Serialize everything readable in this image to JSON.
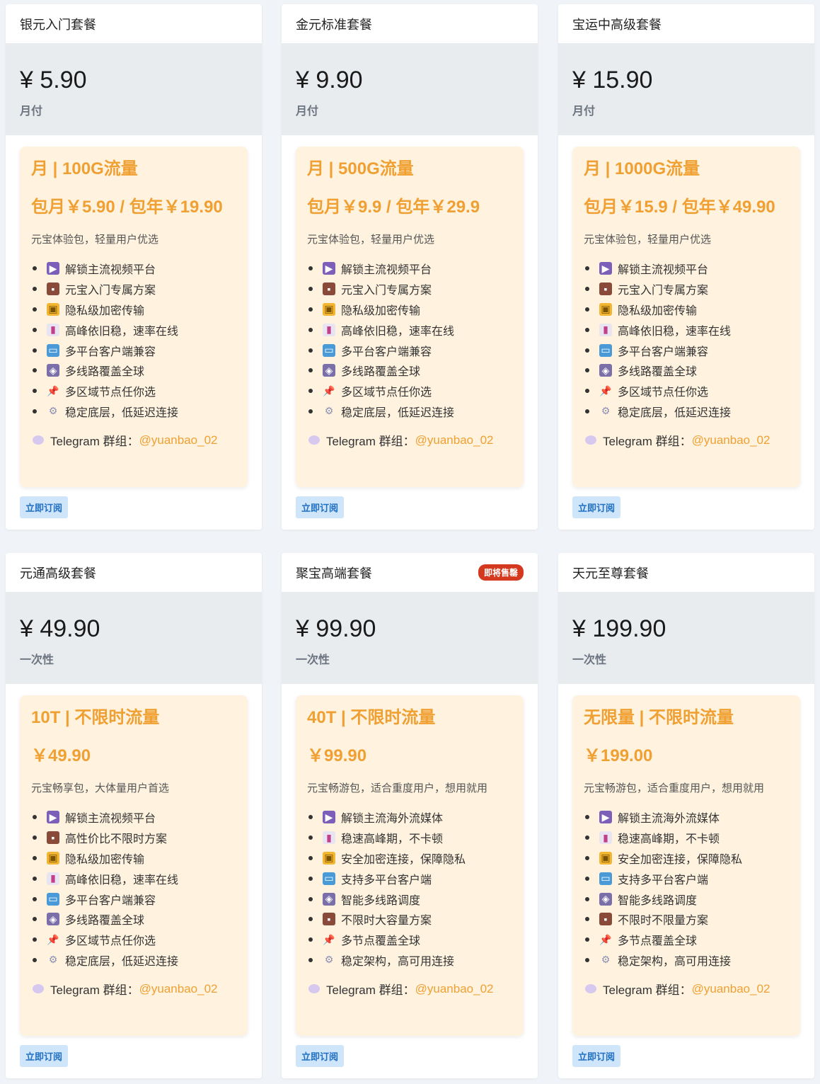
{
  "cards": [
    {
      "name": "银元入门套餐",
      "price": "¥ 5.90",
      "period": "月付",
      "plan_title": "月 | 100G流量",
      "plan_price": "包月￥5.90 / 包年￥19.90",
      "desc": "元宝体验包，轻量用户优选",
      "features": [
        {
          "icon": "film-icon",
          "text": "解锁主流视频平台"
        },
        {
          "icon": "briefcase-icon",
          "text": "元宝入门专属方案"
        },
        {
          "icon": "lock-icon",
          "text": "隐私级加密传输"
        },
        {
          "icon": "chart-icon",
          "text": "高峰依旧稳，速率在线"
        },
        {
          "icon": "computer-icon",
          "text": "多平台客户端兼容"
        },
        {
          "icon": "satellite-icon",
          "text": "多线路覆盖全球"
        },
        {
          "icon": "pin-icon",
          "text": "多区域节点任你选"
        },
        {
          "icon": "gear-icon",
          "text": "稳定底层，低延迟连接"
        }
      ],
      "tg_label": "Telegram 群组：",
      "tg_handle": "@yuanbao_02",
      "button": "立即订阅"
    },
    {
      "name": "金元标准套餐",
      "price": "¥ 9.90",
      "period": "月付",
      "plan_title": "月 | 500G流量",
      "plan_price": "包月￥9.9 / 包年￥29.9",
      "desc": "元宝体验包，轻量用户优选",
      "features": [
        {
          "icon": "film-icon",
          "text": "解锁主流视频平台"
        },
        {
          "icon": "briefcase-icon",
          "text": "元宝入门专属方案"
        },
        {
          "icon": "lock-icon",
          "text": "隐私级加密传输"
        },
        {
          "icon": "chart-icon",
          "text": "高峰依旧稳，速率在线"
        },
        {
          "icon": "computer-icon",
          "text": "多平台客户端兼容"
        },
        {
          "icon": "satellite-icon",
          "text": "多线路覆盖全球"
        },
        {
          "icon": "pin-icon",
          "text": "多区域节点任你选"
        },
        {
          "icon": "gear-icon",
          "text": "稳定底层，低延迟连接"
        }
      ],
      "tg_label": "Telegram 群组：",
      "tg_handle": "@yuanbao_02",
      "button": "立即订阅"
    },
    {
      "name": "宝运中高级套餐",
      "price": "¥ 15.90",
      "period": "月付",
      "plan_title": "月 | 1000G流量",
      "plan_price": "包月￥15.9 / 包年￥49.90",
      "desc": "元宝体验包，轻量用户优选",
      "features": [
        {
          "icon": "film-icon",
          "text": "解锁主流视频平台"
        },
        {
          "icon": "briefcase-icon",
          "text": "元宝入门专属方案"
        },
        {
          "icon": "lock-icon",
          "text": "隐私级加密传输"
        },
        {
          "icon": "chart-icon",
          "text": "高峰依旧稳，速率在线"
        },
        {
          "icon": "computer-icon",
          "text": "多平台客户端兼容"
        },
        {
          "icon": "satellite-icon",
          "text": "多线路覆盖全球"
        },
        {
          "icon": "pin-icon",
          "text": "多区域节点任你选"
        },
        {
          "icon": "gear-icon",
          "text": "稳定底层，低延迟连接"
        }
      ],
      "tg_label": "Telegram 群组：",
      "tg_handle": "@yuanbao_02",
      "button": "立即订阅"
    },
    {
      "name": "元通高级套餐",
      "price": "¥ 49.90",
      "period": "一次性",
      "plan_title": "10T | 不限时流量",
      "plan_price": "￥49.90",
      "desc": "元宝畅享包，大体量用户首选",
      "features": [
        {
          "icon": "film-icon",
          "text": "解锁主流视频平台"
        },
        {
          "icon": "briefcase-icon",
          "text": "高性价比不限时方案"
        },
        {
          "icon": "lock-icon",
          "text": "隐私级加密传输"
        },
        {
          "icon": "chart-icon",
          "text": "高峰依旧稳，速率在线"
        },
        {
          "icon": "computer-icon",
          "text": "多平台客户端兼容"
        },
        {
          "icon": "satellite-icon",
          "text": "多线路覆盖全球"
        },
        {
          "icon": "pin-icon",
          "text": "多区域节点任你选"
        },
        {
          "icon": "gear-icon",
          "text": "稳定底层，低延迟连接"
        }
      ],
      "tg_label": "Telegram 群组：",
      "tg_handle": "@yuanbao_02",
      "button": "立即订阅"
    },
    {
      "name": "聚宝高端套餐",
      "badge": "即将售罄",
      "price": "¥ 99.90",
      "period": "一次性",
      "plan_title": "40T | 不限时流量",
      "plan_price": "￥99.90",
      "desc": "元宝畅游包，适合重度用户，想用就用",
      "features": [
        {
          "icon": "film-icon",
          "text": "解锁主流海外流媒体"
        },
        {
          "icon": "chart-icon",
          "text": "稳速高峰期，不卡顿"
        },
        {
          "icon": "lock-icon",
          "text": "安全加密连接，保障隐私"
        },
        {
          "icon": "computer-icon",
          "text": "支持多平台客户端"
        },
        {
          "icon": "satellite-icon",
          "text": "智能多线路调度"
        },
        {
          "icon": "briefcase-icon",
          "text": "不限时大容量方案"
        },
        {
          "icon": "pin-icon",
          "text": "多节点覆盖全球"
        },
        {
          "icon": "gear-icon",
          "text": "稳定架构，高可用连接"
        }
      ],
      "tg_label": "Telegram 群组：",
      "tg_handle": "@yuanbao_02",
      "button": "立即订阅"
    },
    {
      "name": "天元至尊套餐",
      "price": "¥ 199.90",
      "period": "一次性",
      "plan_title": "无限量 | 不限时流量",
      "plan_price": "￥199.00",
      "desc": "元宝畅游包，适合重度用户，想用就用",
      "features": [
        {
          "icon": "film-icon",
          "text": "解锁主流海外流媒体"
        },
        {
          "icon": "chart-icon",
          "text": "稳速高峰期，不卡顿"
        },
        {
          "icon": "lock-icon",
          "text": "安全加密连接，保障隐私"
        },
        {
          "icon": "computer-icon",
          "text": "支持多平台客户端"
        },
        {
          "icon": "satellite-icon",
          "text": "智能多线路调度"
        },
        {
          "icon": "briefcase-icon",
          "text": "不限时不限量方案"
        },
        {
          "icon": "pin-icon",
          "text": "多节点覆盖全球"
        },
        {
          "icon": "gear-icon",
          "text": "稳定架构，高可用连接"
        }
      ],
      "tg_label": "Telegram 群组：",
      "tg_handle": "@yuanbao_02",
      "button": "立即订阅"
    }
  ],
  "colors": {
    "accent": "#f0a032",
    "badge": "#d4391f",
    "button_bg": "#cfe5fa",
    "button_text": "#1f6fc2"
  }
}
